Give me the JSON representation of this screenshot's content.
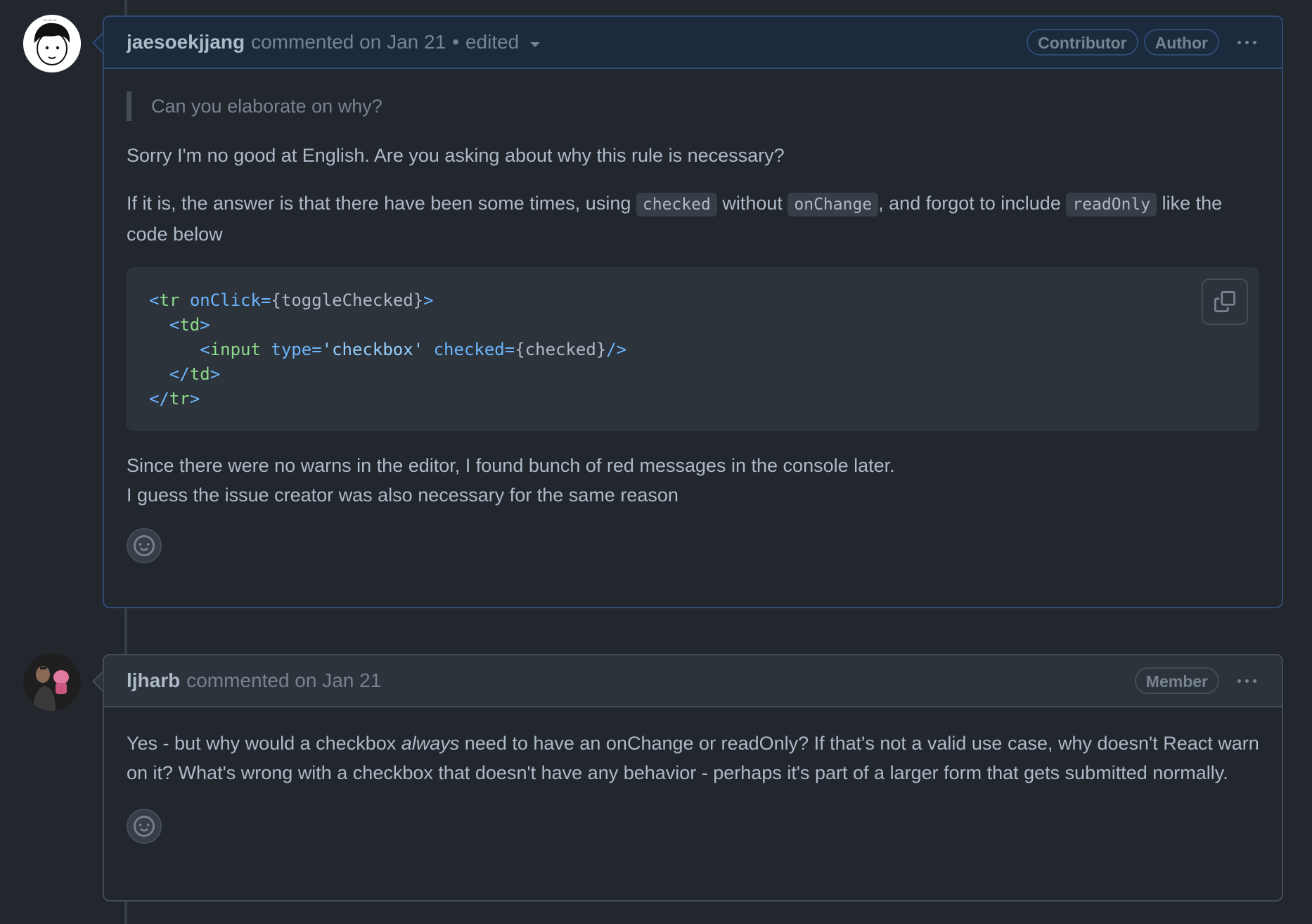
{
  "comments": [
    {
      "author": "jaesoekjjang",
      "meta": "commented on Jan 21",
      "separator": "•",
      "edited": "edited",
      "badges": [
        "Contributor",
        "Author"
      ],
      "quote": "Can you elaborate on why?",
      "p1": "Sorry I'm no good at English. Are you asking about why this rule is necessary?",
      "p2_part1": "If it is, the answer is that there have been some times, using ",
      "p2_code1": "checked",
      "p2_part2": " without ",
      "p2_code2": "onChange",
      "p2_part3": ", and forgot to include ",
      "p2_code3": "readOnly",
      "p2_part4": " like the code below",
      "code_lines": [
        "<tr onClick={toggleChecked}>",
        "  <td>",
        "     <input type='checkbox' checked={checked}/>",
        "  </td>",
        "</tr>"
      ],
      "p3_line1": "Since there were no warns in the editor, I found bunch of red messages in the console later.",
      "p3_line2": "I guess the issue creator was also necessary for the same reason",
      "avatar_icon": "cartoon-face-avatar"
    },
    {
      "author": "ljharb",
      "meta": "commented on Jan 21",
      "badges": [
        "Member"
      ],
      "p1_part1": "Yes - but why would a checkbox ",
      "p1_em": "always",
      "p1_part2": " need to have an onChange or readOnly? If that's not a valid use case, why doesn't React warn on it? What's wrong with a checkbox that doesn't have any behavior - perhaps it's part of a larger form that gets submitted normally.",
      "avatar_icon": "photo-avatar"
    }
  ],
  "icons": {
    "copy": "copy-icon",
    "smiley": "smiley-icon",
    "kebab": "kebab-horizontal-icon",
    "dropdown": "triangle-down-icon"
  },
  "colors": {
    "background": "#22272e",
    "header_owner": "#1c2a3d",
    "header_default": "#2d333b",
    "border_owner": "#2f4a73",
    "border_default": "#444c56"
  }
}
